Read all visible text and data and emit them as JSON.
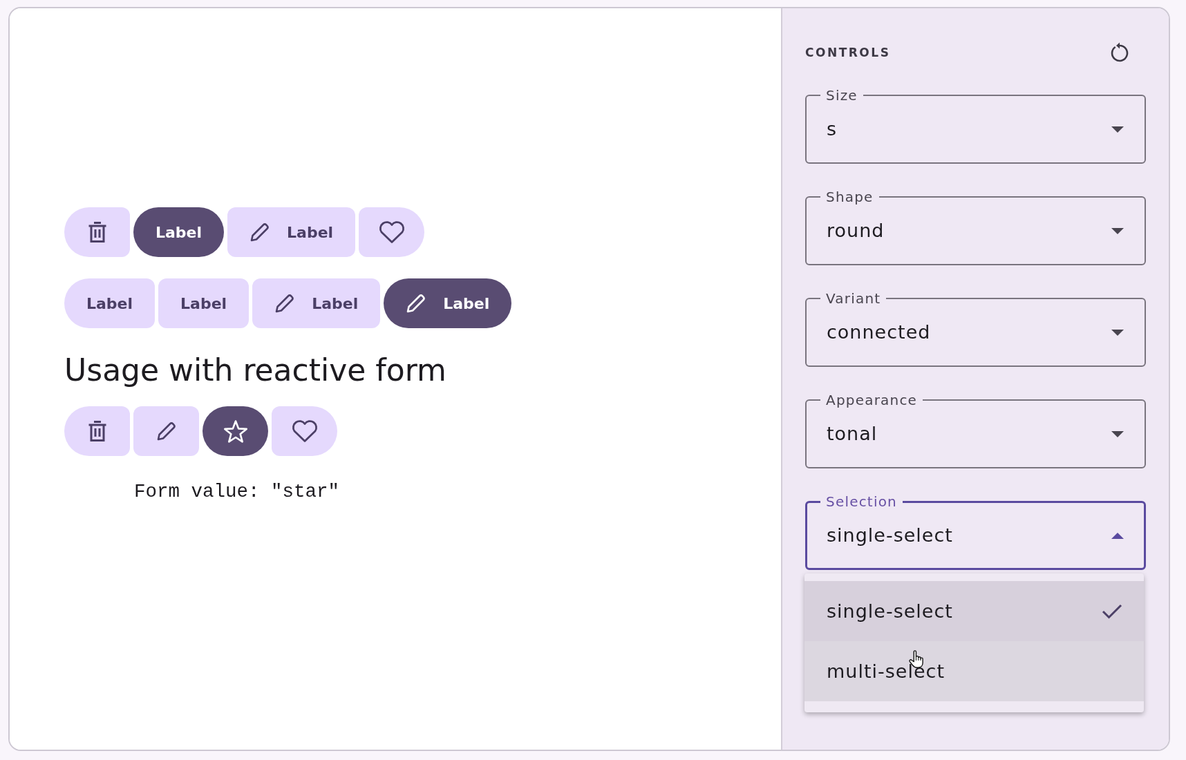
{
  "demo": {
    "button_groups": [
      {
        "buttons": [
          {
            "kind": "trash",
            "selected": false
          },
          {
            "kind": "text",
            "label": "Label",
            "selected": true
          },
          {
            "kind": "pencil",
            "label": "Label",
            "selected": false
          },
          {
            "kind": "heart",
            "selected": false
          }
        ]
      },
      {
        "buttons": [
          {
            "kind": "text",
            "label": "Label",
            "selected": false
          },
          {
            "kind": "text",
            "label": "Label",
            "selected": false
          },
          {
            "kind": "pencil",
            "label": "Label",
            "selected": false
          },
          {
            "kind": "pencil",
            "label": "Label",
            "selected": true
          }
        ]
      }
    ],
    "heading": "Usage with reactive form",
    "form_group": {
      "buttons": [
        {
          "kind": "trash",
          "selected": false
        },
        {
          "kind": "pencil",
          "selected": false
        },
        {
          "kind": "star",
          "selected": true
        },
        {
          "kind": "heart",
          "selected": false
        }
      ]
    },
    "form_value": "Form value: \"star\""
  },
  "controls": {
    "title": "CONTROLS",
    "fields": [
      {
        "label": "Size",
        "value": "s",
        "expanded": false
      },
      {
        "label": "Shape",
        "value": "round",
        "expanded": false
      },
      {
        "label": "Variant",
        "value": "connected",
        "expanded": false
      },
      {
        "label": "Appearance",
        "value": "tonal",
        "expanded": false
      },
      {
        "label": "Selection",
        "value": "single-select",
        "expanded": true,
        "options": [
          {
            "label": "single-select",
            "selected": true,
            "hovered": false
          },
          {
            "label": "multi-select",
            "selected": false,
            "hovered": true
          }
        ]
      }
    ]
  }
}
